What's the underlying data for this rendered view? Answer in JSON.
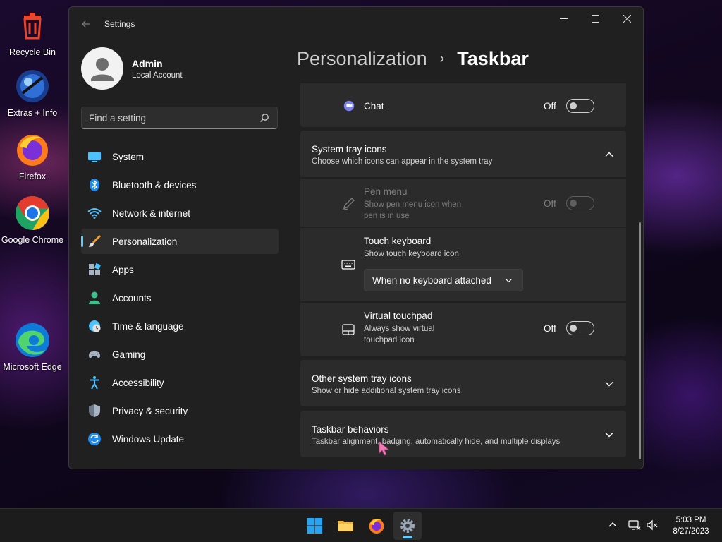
{
  "desktop": {
    "icons": [
      {
        "label": "Recycle Bin"
      },
      {
        "label": "Extras + Info"
      },
      {
        "label": "Firefox"
      },
      {
        "label": "Google Chrome"
      },
      {
        "label": "Microsoft Edge"
      }
    ]
  },
  "window": {
    "title": "Settings"
  },
  "profile": {
    "name": "Admin",
    "account_type": "Local Account"
  },
  "search": {
    "placeholder": "Find a setting"
  },
  "sidebar": {
    "items": [
      {
        "label": "System"
      },
      {
        "label": "Bluetooth & devices"
      },
      {
        "label": "Network & internet"
      },
      {
        "label": "Personalization"
      },
      {
        "label": "Apps"
      },
      {
        "label": "Accounts"
      },
      {
        "label": "Time & language"
      },
      {
        "label": "Gaming"
      },
      {
        "label": "Accessibility"
      },
      {
        "label": "Privacy & security"
      },
      {
        "label": "Windows Update"
      }
    ],
    "active_index": 3
  },
  "breadcrumb": {
    "parent": "Personalization",
    "separator": "›",
    "current": "Taskbar"
  },
  "settings": {
    "chat": {
      "title": "Chat",
      "state": "Off"
    },
    "system_tray": {
      "title": "System tray icons",
      "description": "Choose which icons can appear in the system tray",
      "pen_menu": {
        "title": "Pen menu",
        "description_line1": "Show pen menu icon when",
        "description_line2": "pen is in use",
        "state": "Off"
      },
      "touch_keyboard": {
        "title": "Touch keyboard",
        "description": "Show touch keyboard icon",
        "dropdown_value": "When no keyboard attached"
      },
      "virtual_touchpad": {
        "title": "Virtual touchpad",
        "description_line1": "Always show virtual",
        "description_line2": "touchpad icon",
        "state": "Off"
      }
    },
    "other_tray": {
      "title": "Other system tray icons",
      "description": "Show or hide additional system tray icons"
    },
    "behaviors": {
      "title": "Taskbar behaviors",
      "description": "Taskbar alignment, badging, automatically hide, and multiple displays"
    }
  },
  "taskbar": {
    "time": "5:03 PM",
    "date": "8/27/2023"
  },
  "colors": {
    "accent": "#60cdff",
    "window_bg": "#202020",
    "card_bg": "#2b2b2b"
  }
}
